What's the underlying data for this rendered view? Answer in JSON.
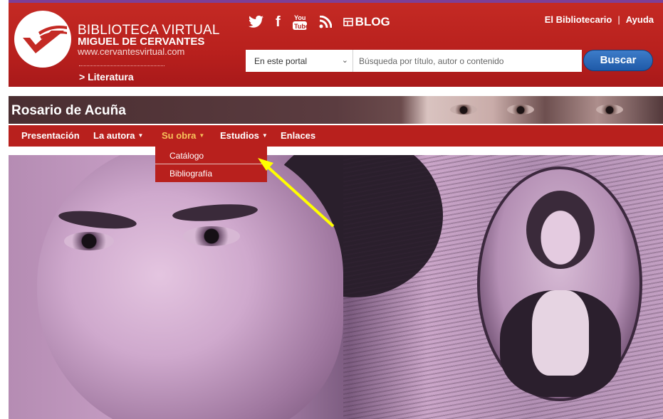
{
  "header": {
    "brand_line1": "BIBLIOTECA VIRTUAL",
    "brand_line2": "MIGUEL DE CERVANTES",
    "brand_url": "www.cervantesvirtual.com",
    "section_link": "> Literatura",
    "social_icons": [
      "twitter-icon",
      "facebook-icon",
      "youtube-icon",
      "rss-icon",
      "blog-icon"
    ],
    "blog_label": "BLOG",
    "links": {
      "bibliotecario": "El Bibliotecario",
      "separator": "|",
      "ayuda": "Ayuda"
    },
    "search": {
      "scope": "En este portal",
      "placeholder": "Búsqueda por título, autor o contenido",
      "button": "Buscar"
    }
  },
  "banner": {
    "title": "Rosario de Acuña"
  },
  "nav": {
    "items": [
      {
        "label": "Presentación",
        "has_caret": false
      },
      {
        "label": "La autora",
        "has_caret": true
      },
      {
        "label": "Su obra",
        "has_caret": true,
        "active": true
      },
      {
        "label": "Estudios",
        "has_caret": true
      },
      {
        "label": "Enlaces",
        "has_caret": false
      }
    ],
    "dropdown": [
      "Catálogo",
      "Bibliografía"
    ]
  },
  "colors": {
    "header_red": "#b8201d",
    "active_nav": "#f7c25b",
    "search_button": "#1f5aa8",
    "top_line": "#7d3f98",
    "annotation_arrow": "#ffff00"
  }
}
